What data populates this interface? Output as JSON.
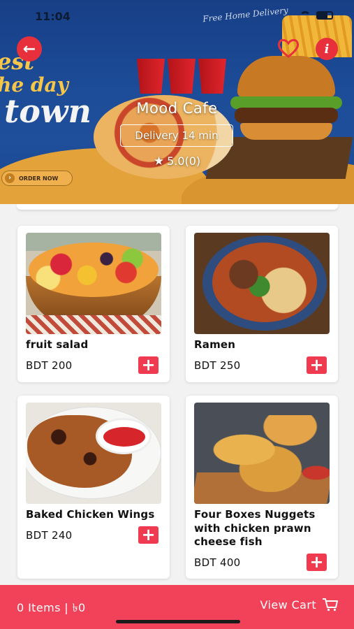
{
  "status_bar": {
    "time": "11:04"
  },
  "banner": {
    "promo_line1": "est",
    "promo_line2": "he day",
    "promo_line3": "town",
    "free_delivery": "Free Home Delivery",
    "order_now": "ORDER NOW"
  },
  "restaurant": {
    "name": "Mood Cafe",
    "delivery": "Delivery 14 min",
    "rating": "5.0(0)"
  },
  "icons": {
    "back": "arrow-left-icon",
    "favorite": "heart-outline-icon",
    "info": "info-icon",
    "star": "star-icon",
    "add": "plus-icon",
    "cart": "cart-icon"
  },
  "colors": {
    "accent": "#ef3a50",
    "bottom_bar": "#f2425a",
    "banner_blue": "#1d4c98",
    "banner_orange": "#e3a23a"
  },
  "products": [
    {
      "name": "fruit salad",
      "price": "BDT 200"
    },
    {
      "name": "Ramen",
      "price": "BDT 250"
    },
    {
      "name": "Baked Chicken Wings",
      "price": "BDT 240"
    },
    {
      "name": "Four Boxes Nuggets with chicken prawn cheese fish",
      "price": "BDT 400"
    }
  ],
  "cart": {
    "summary": "0 Items | ৳0",
    "view_cart": "View Cart"
  }
}
